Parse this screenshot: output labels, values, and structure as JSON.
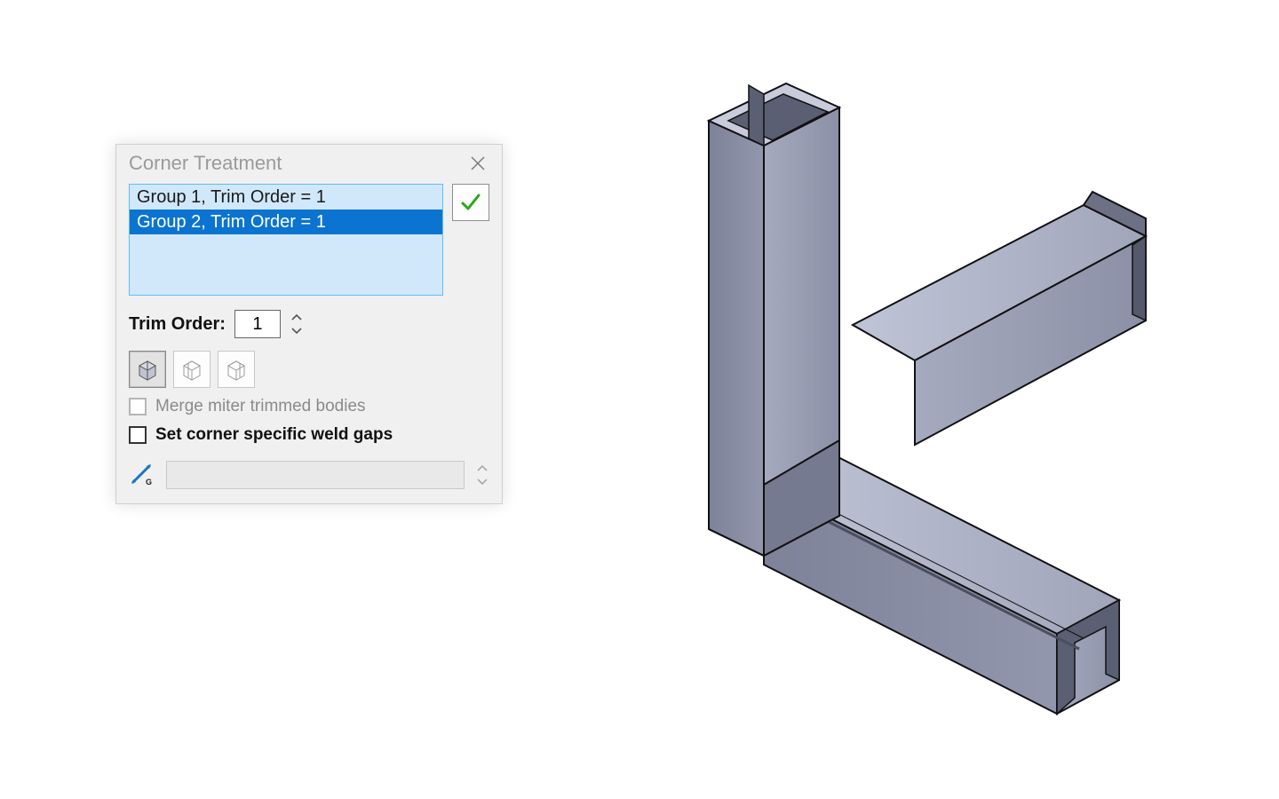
{
  "dialog": {
    "title": "Corner Treatment",
    "groups": {
      "items": [
        {
          "label": "Group 1, Trim Order = 1",
          "selected": false
        },
        {
          "label": "Group 2, Trim Order = 1",
          "selected": true
        }
      ]
    },
    "trim_order": {
      "label": "Trim Order:",
      "value": "1"
    },
    "trim_modes": {
      "options": [
        {
          "name": "trim-mode-miter",
          "active": true
        },
        {
          "name": "trim-mode-butt1",
          "active": false
        },
        {
          "name": "trim-mode-butt2",
          "active": false
        }
      ]
    },
    "merge_miter": {
      "label": "Merge miter trimmed bodies",
      "checked": false,
      "enabled": false
    },
    "set_weld_gaps": {
      "label": "Set corner specific weld gaps",
      "checked": false,
      "enabled": true
    },
    "weld_gap": {
      "icon": "weld-gap-icon",
      "value": ""
    }
  },
  "colors": {
    "accent": "#0b74d1",
    "list_bg": "#d1e8fb",
    "list_border": "#5fbdf6",
    "confirm_green": "#2aa516",
    "steel_light": "#a9adc1",
    "steel_mid": "#898ea3",
    "steel_dark": "#6c7186"
  }
}
